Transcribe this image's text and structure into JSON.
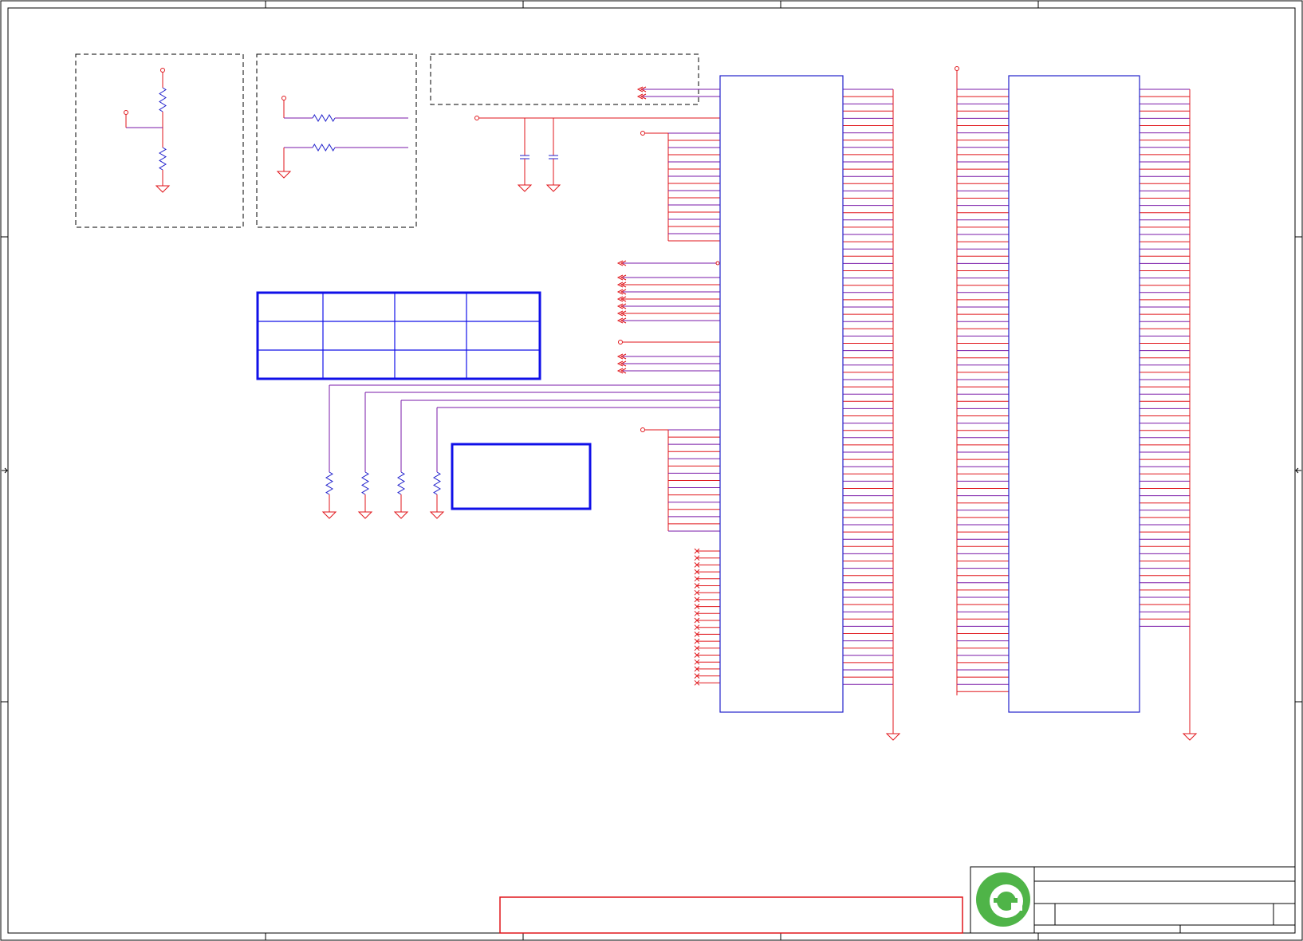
{
  "logo": {
    "icon": "green-e-logo-icon"
  },
  "colors": {
    "wire": "#e0161b",
    "component": "#2222cc",
    "bus_line": "#7a1aa8",
    "table_border": "#1010e8",
    "frame": "#000000",
    "dashed_box": "#000000",
    "logo_green": "#4fb448",
    "logo_white": "#ffffff",
    "warning_box": "#e0161b"
  }
}
